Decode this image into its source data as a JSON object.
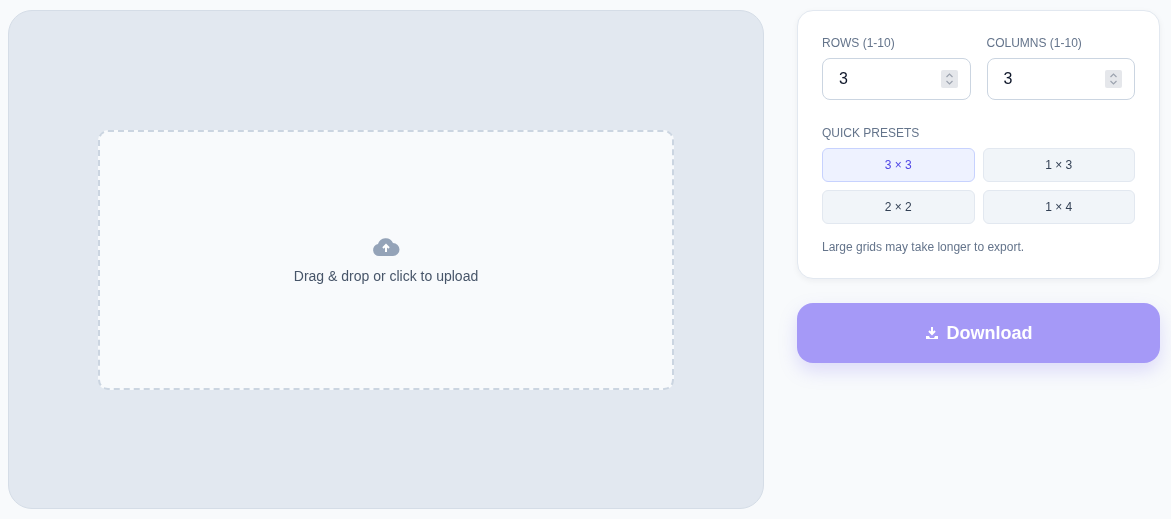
{
  "upload": {
    "text": "Drag & drop or click to upload"
  },
  "settings": {
    "rows": {
      "label": "ROWS (1-10)",
      "value": "3"
    },
    "columns": {
      "label": "COLUMNS (1-10)",
      "value": "3"
    },
    "presets_label": "QUICK PRESETS",
    "presets": [
      {
        "label": "3 × 3",
        "selected": true
      },
      {
        "label": "1 × 3",
        "selected": false
      },
      {
        "label": "2 × 2",
        "selected": false
      },
      {
        "label": "1 × 4",
        "selected": false
      }
    ],
    "note": "Large grids may take longer to export."
  },
  "download": {
    "label": "Download",
    "disabled": true
  }
}
